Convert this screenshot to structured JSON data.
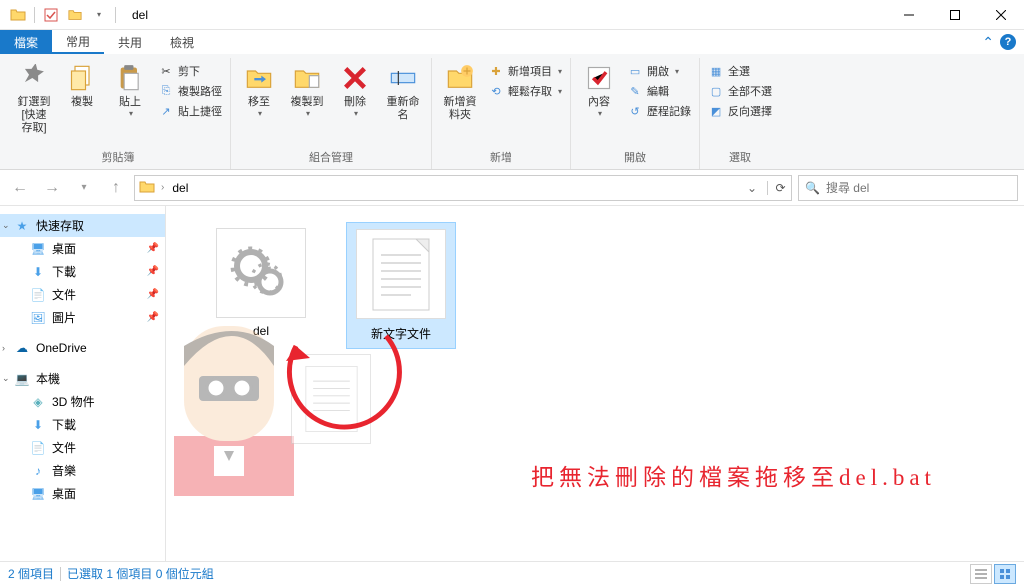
{
  "title": "del",
  "tabs": {
    "file": "檔案",
    "home": "常用",
    "share": "共用",
    "view": "檢視"
  },
  "ribbon": {
    "clipboard": {
      "label": "剪貼簿",
      "pin": "釘選到 [快速存取]",
      "copy": "複製",
      "paste": "貼上",
      "cut": "剪下",
      "copypath": "複製路徑",
      "pasteshortcut": "貼上捷徑"
    },
    "organize": {
      "label": "組合管理",
      "moveto": "移至",
      "copyto": "複製到",
      "delete": "刪除",
      "rename": "重新命名"
    },
    "new": {
      "label": "新增",
      "newfolder": "新增資料夾",
      "newitem": "新增項目",
      "easyaccess": "輕鬆存取"
    },
    "open": {
      "label": "開啟",
      "properties": "內容",
      "open": "開啟",
      "edit": "編輯",
      "history": "歷程記錄"
    },
    "select": {
      "label": "選取",
      "all": "全選",
      "none": "全部不選",
      "invert": "反向選擇"
    }
  },
  "breadcrumb": {
    "folder": "del"
  },
  "search": {
    "placeholder": "搜尋 del"
  },
  "sidebar": {
    "quickaccess": "快速存取",
    "desktop": "桌面",
    "downloads": "下載",
    "documents": "文件",
    "pictures": "圖片",
    "onedrive": "OneDrive",
    "thispc": "本機",
    "objects3d": "3D 物件",
    "downloads2": "下載",
    "documents2": "文件",
    "music": "音樂",
    "desktop2": "桌面"
  },
  "files": {
    "del": "del",
    "newtext": "新文字文件"
  },
  "annotation": "把無法刪除的檔案拖移至del.bat",
  "status": {
    "count": "2 個項目",
    "selected": "已選取 1 個項目 0 個位元組"
  }
}
